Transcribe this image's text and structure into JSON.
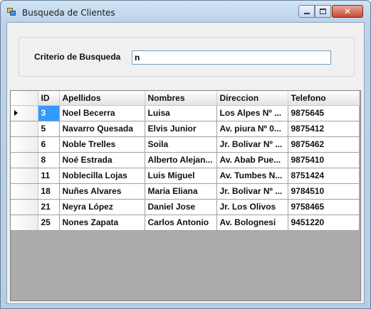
{
  "window": {
    "title": "Busqueda de Clientes",
    "icon": "form-app-icon"
  },
  "search": {
    "label": "Criterio de Busqueda",
    "value": "n"
  },
  "grid": {
    "columns": [
      "ID",
      "Apellidos",
      "Nombres",
      "Direccion",
      "Telefono"
    ],
    "current_row_index": 0,
    "selected_cell": {
      "row": 0,
      "column": "ID"
    },
    "rows": [
      {
        "id": "3",
        "apellidos": "Noel Becerra",
        "nombres": "Luisa",
        "direccion": "Los Alpes Nº ...",
        "telefono": "9875645"
      },
      {
        "id": "5",
        "apellidos": "Navarro Quesada",
        "nombres": "Elvis Junior",
        "direccion": "Av. piura Nº 0...",
        "telefono": "9875412"
      },
      {
        "id": "6",
        "apellidos": "Noble Trelles",
        "nombres": "Soila",
        "direccion": "Jr. Bolivar Nº ...",
        "telefono": "9875462"
      },
      {
        "id": "8",
        "apellidos": "Noé Estrada",
        "nombres": "Alberto Alejan...",
        "direccion": "Av. Abab Pue...",
        "telefono": "9875410"
      },
      {
        "id": "11",
        "apellidos": "Noblecilla Lojas",
        "nombres": "Luis Miguel",
        "direccion": "Av. Tumbes N...",
        "telefono": "8751424"
      },
      {
        "id": "18",
        "apellidos": "Nuñes Alvares",
        "nombres": "Maria Eliana",
        "direccion": "Jr. Bolivar Nº ...",
        "telefono": "9784510"
      },
      {
        "id": "21",
        "apellidos": "Neyra López",
        "nombres": "Daniel Jose",
        "direccion": "Jr. Los Olivos",
        "telefono": "9758465"
      },
      {
        "id": "25",
        "apellidos": "Nones Zapata",
        "nombres": "Carlos Antonio",
        "direccion": "Av. Bolognesi",
        "telefono": "9451220"
      }
    ]
  },
  "colors": {
    "selection": "#3399ff",
    "grid_background": "#ababab",
    "form_background": "#f0f0f0",
    "close_button": "#c84a33"
  }
}
